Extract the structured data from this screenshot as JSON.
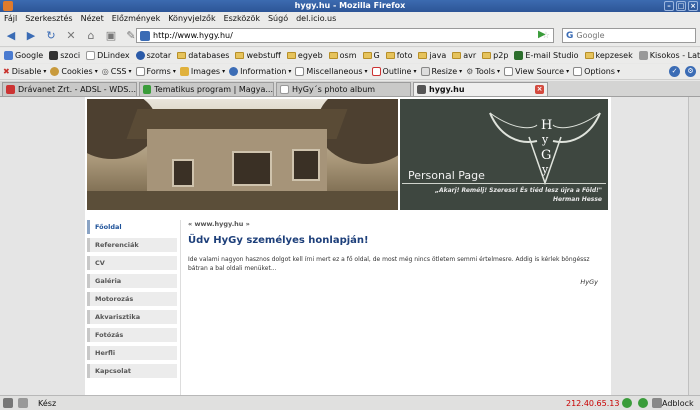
{
  "window": {
    "title": "hygy.hu - Mozilla Firefox"
  },
  "menu": [
    "Fájl",
    "Szerkesztés",
    "Nézet",
    "Előzmények",
    "Könyvjelzők",
    "Eszközök",
    "Súgó",
    "del.icio.us"
  ],
  "nav": {
    "url": "http://www.hygy.hu/",
    "search_placeholder": "Google"
  },
  "bookmarks": [
    "Google",
    "szoci",
    "DLindex",
    "szotar",
    "databases",
    "webstuff",
    "egyeb",
    "osm",
    "G",
    "foto",
    "java",
    "avr",
    "p2p",
    "E-mail Studio",
    "kepzesek",
    "Kisokos - Latin száll..."
  ],
  "devtools": [
    "Disable",
    "Cookies",
    "CSS",
    "Forms",
    "Images",
    "Information",
    "Miscellaneous",
    "Outline",
    "Resize",
    "Tools",
    "View Source",
    "Options"
  ],
  "tabs": [
    "Drávanet Zrt. - ADSL - WDS...",
    "Tematikus program | Magya...",
    "HyGy´s photo album",
    "hygy.hu"
  ],
  "header": {
    "logo_text": "HyGy",
    "personal": "Personal Page",
    "quote": "„Akarj! Remélj! Szeress! És tiéd lesz újra a Föld!\"",
    "author": "Herman Hesse"
  },
  "sidebar": [
    "Főoldal",
    "Referenciák",
    "CV",
    "Galéria",
    "Motorozás",
    "Akvarisztika",
    "Fotózás",
    "Herfli",
    "Kapcsolat"
  ],
  "content": {
    "crumb": "« www.hygy.hu »",
    "title": "Üdv HyGy személyes honlapján!",
    "text": "Ide valami nagyon hasznos dolgot kell írni mert ez a fő oldal, de most még nincs ötletem semmi értelmesre. Addig is kérlek böngéssz bátran a bal oldali menüket...",
    "sign": "HyGy"
  },
  "status": {
    "text": "Kész",
    "ip": "212.40.65.13",
    "adblock": "Adblock"
  }
}
